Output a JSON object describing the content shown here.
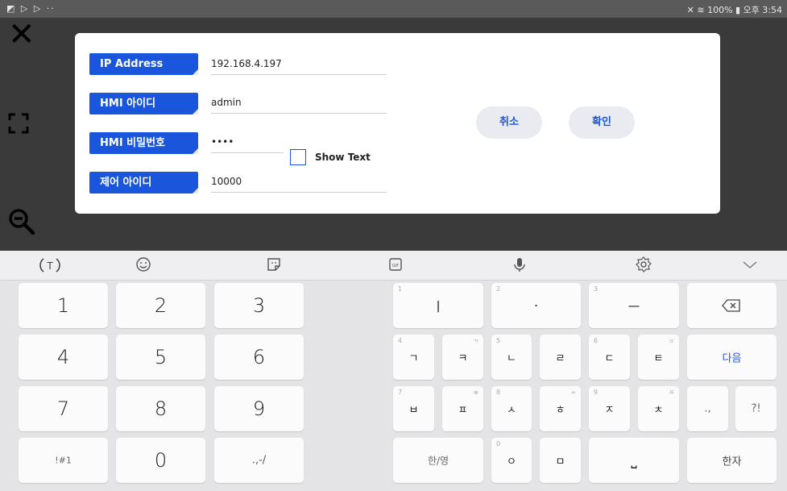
{
  "status_bar": {
    "left_icons": "◩ ▷ ▷ ··",
    "right": "✕ ≋ 100% ▮ 오후 3:54"
  },
  "dialog": {
    "fields": [
      {
        "label": "IP Address",
        "value": "192.168.4.197"
      },
      {
        "label": "HMI 아이디",
        "value": "admin"
      },
      {
        "label": "HMI 비밀번호",
        "value": "••••"
      },
      {
        "label": "제어 아이디",
        "value": "10000"
      }
    ],
    "show_text_label": "Show Text",
    "show_text_checked": false,
    "cancel_label": "취소",
    "confirm_label": "확인",
    "accent_color": "#1a56db"
  },
  "keyboard": {
    "numpad": {
      "row1": [
        "1",
        "2",
        "3"
      ],
      "row2": [
        "4",
        "5",
        "6"
      ],
      "row3": [
        "7",
        "8",
        "9"
      ],
      "row4": [
        "!#1",
        "0",
        ".,-/"
      ]
    },
    "hangul": {
      "r1": [
        {
          "sub": "1",
          "main": "ㅣ"
        },
        {
          "sub": "2",
          "main": "·"
        },
        {
          "sub": "3",
          "main": "ㅡ"
        }
      ],
      "r2": [
        {
          "sub": "4",
          "main": "ㄱ"
        },
        {
          "sub2": "ㄲ",
          "main": "ㅋ"
        },
        {
          "sub": "5",
          "main": "ㄴ"
        },
        {
          "main": "ㄹ"
        },
        {
          "sub": "6",
          "main": "ㄷ"
        },
        {
          "sub2": "ㄸ",
          "main": "ㅌ"
        }
      ],
      "r3": [
        {
          "sub": "7",
          "main": "ㅂ"
        },
        {
          "sub2": "ㅃ",
          "main": "ㅍ"
        },
        {
          "sub": "8",
          "main": "ㅅ"
        },
        {
          "sub2": "ㅆ",
          "main": "ㅎ"
        },
        {
          "sub": "9",
          "main": "ㅈ"
        },
        {
          "sub2": "ㅉ",
          "main": "ㅊ"
        }
      ],
      "r4": [
        {
          "main": "한/영"
        },
        {
          "sub": "0",
          "main": "ㅇ"
        },
        {
          "main": "ㅁ"
        },
        {
          "main": "⎵"
        }
      ],
      "backspace": "⌫",
      "next": "다음",
      "punct1": ".,",
      "punct2": "?!",
      "hanja": "한자"
    },
    "toolbar_icons": [
      "text-mode-icon",
      "emoji-icon",
      "sticker-icon",
      "gif-icon",
      "mic-icon",
      "settings-icon",
      "collapse-icon"
    ]
  }
}
